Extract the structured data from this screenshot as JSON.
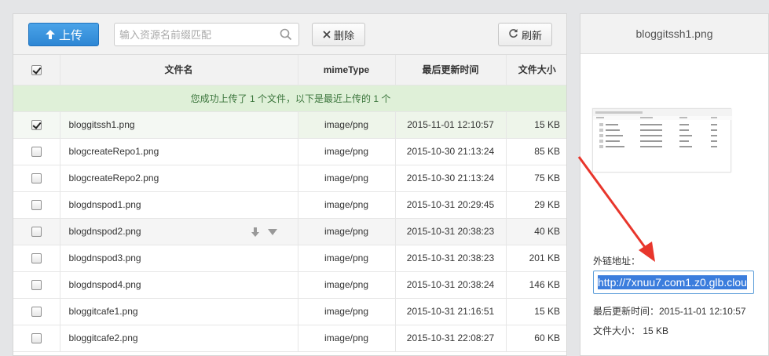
{
  "toolbar": {
    "upload_label": "上传",
    "search_placeholder": "输入资源名前缀匹配",
    "delete_label": "删除",
    "refresh_label": "刷新"
  },
  "table": {
    "headers": {
      "name": "文件名",
      "mime": "mimeType",
      "time": "最后更新时间",
      "size": "文件大小"
    },
    "notice": "您成功上传了 1 个文件，以下是最近上传的 1 个",
    "rows": [
      {
        "name": "bloggitssh1.png",
        "mime": "image/png",
        "time": "2015-11-01 12:10:57",
        "size": "15 KB",
        "checked": true
      },
      {
        "name": "blogcreateRepo1.png",
        "mime": "image/png",
        "time": "2015-10-30 21:13:24",
        "size": "85 KB",
        "checked": false
      },
      {
        "name": "blogcreateRepo2.png",
        "mime": "image/png",
        "time": "2015-10-30 21:13:24",
        "size": "75 KB",
        "checked": false
      },
      {
        "name": "blogdnspod1.png",
        "mime": "image/png",
        "time": "2015-10-31 20:29:45",
        "size": "29 KB",
        "checked": false
      },
      {
        "name": "blogdnspod2.png",
        "mime": "image/png",
        "time": "2015-10-31 20:38:23",
        "size": "40 KB",
        "checked": false
      },
      {
        "name": "blogdnspod3.png",
        "mime": "image/png",
        "time": "2015-10-31 20:38:23",
        "size": "201 KB",
        "checked": false
      },
      {
        "name": "blogdnspod4.png",
        "mime": "image/png",
        "time": "2015-10-31 20:38:24",
        "size": "146 KB",
        "checked": false
      },
      {
        "name": "bloggitcafe1.png",
        "mime": "image/png",
        "time": "2015-10-31 21:16:51",
        "size": "15 KB",
        "checked": false
      },
      {
        "name": "bloggitcafe2.png",
        "mime": "image/png",
        "time": "2015-10-31 22:08:27",
        "size": "60 KB",
        "checked": false
      }
    ]
  },
  "detail": {
    "title": "bloggitssh1.png",
    "link_label": "外链地址：",
    "link_value": "http://7xnuu7.com1.z0.glb.clou",
    "updated_label": "最后更新时间：2015-11-01 12:10:57",
    "size_label": "文件大小： 15 KB"
  },
  "icons": {
    "upload": "arrow-up-icon",
    "search": "search-icon",
    "delete": "close-icon",
    "refresh": "refresh-icon",
    "download": "download-icon",
    "more": "caret-down-icon"
  },
  "colors": {
    "primary": "#2d86d4",
    "notice_bg": "#dff0d8",
    "notice_text": "#3c763d",
    "arrow": "#e8362c"
  }
}
